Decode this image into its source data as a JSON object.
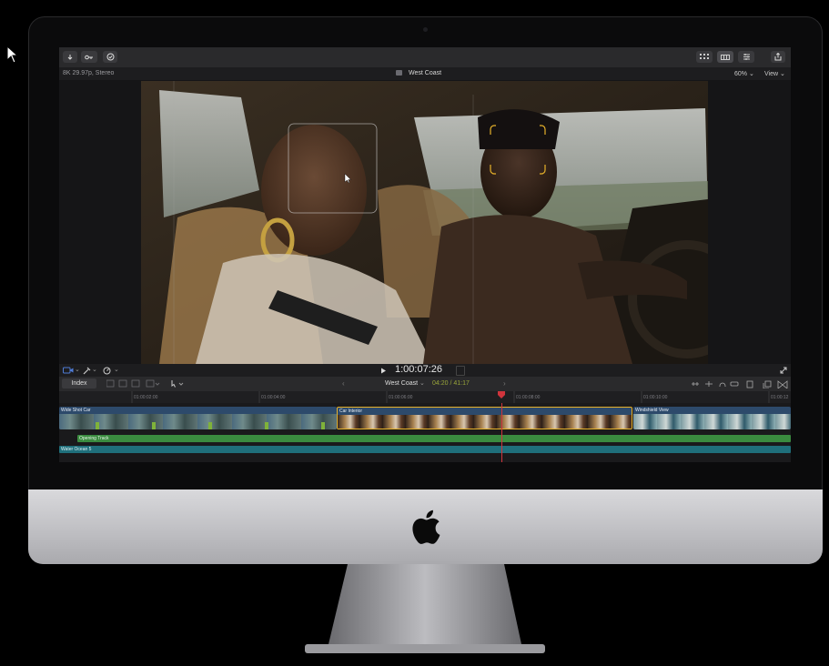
{
  "colors": {
    "accent_yellow": "#e6b12a",
    "playhead_red": "#d0343c",
    "audio_green": "#3a8b3f",
    "audio_teal": "#1f6f7b",
    "primary_clip_blue": "#2d4a6b",
    "timecode_olive": "#9aa63a"
  },
  "toolbar": {
    "left_icons": [
      "import-icon",
      "keyword-icon",
      "analysis-check-icon"
    ],
    "right_icons": [
      "grid-view-icon",
      "filmstrip-view-icon",
      "inspector-sliders-icon",
      "share-icon"
    ]
  },
  "viewer": {
    "format_info": "8K 29.97p, Stereo",
    "project_title": "West Coast",
    "zoom": "60%",
    "view_menu": "View"
  },
  "transport": {
    "timecode": "1:00:07:26"
  },
  "timeline_header": {
    "index_label": "Index",
    "project_name": "West Coast",
    "position": "04:20 / 41:17"
  },
  "ruler": {
    "ticks": [
      "01:00:02:00",
      "01:00:04:00",
      "01:00:06:00",
      "01:00:08:00",
      "01:00:10:00",
      "01:00:12"
    ]
  },
  "clips": {
    "primary": [
      {
        "label": "Wide Shot Car",
        "selected": false
      },
      {
        "label": "Car Interior",
        "selected": true
      },
      {
        "label": "Windshield View",
        "selected": false
      }
    ],
    "audio": [
      {
        "label": "Opening Track"
      },
      {
        "label": "Water Ocean 5"
      }
    ]
  }
}
